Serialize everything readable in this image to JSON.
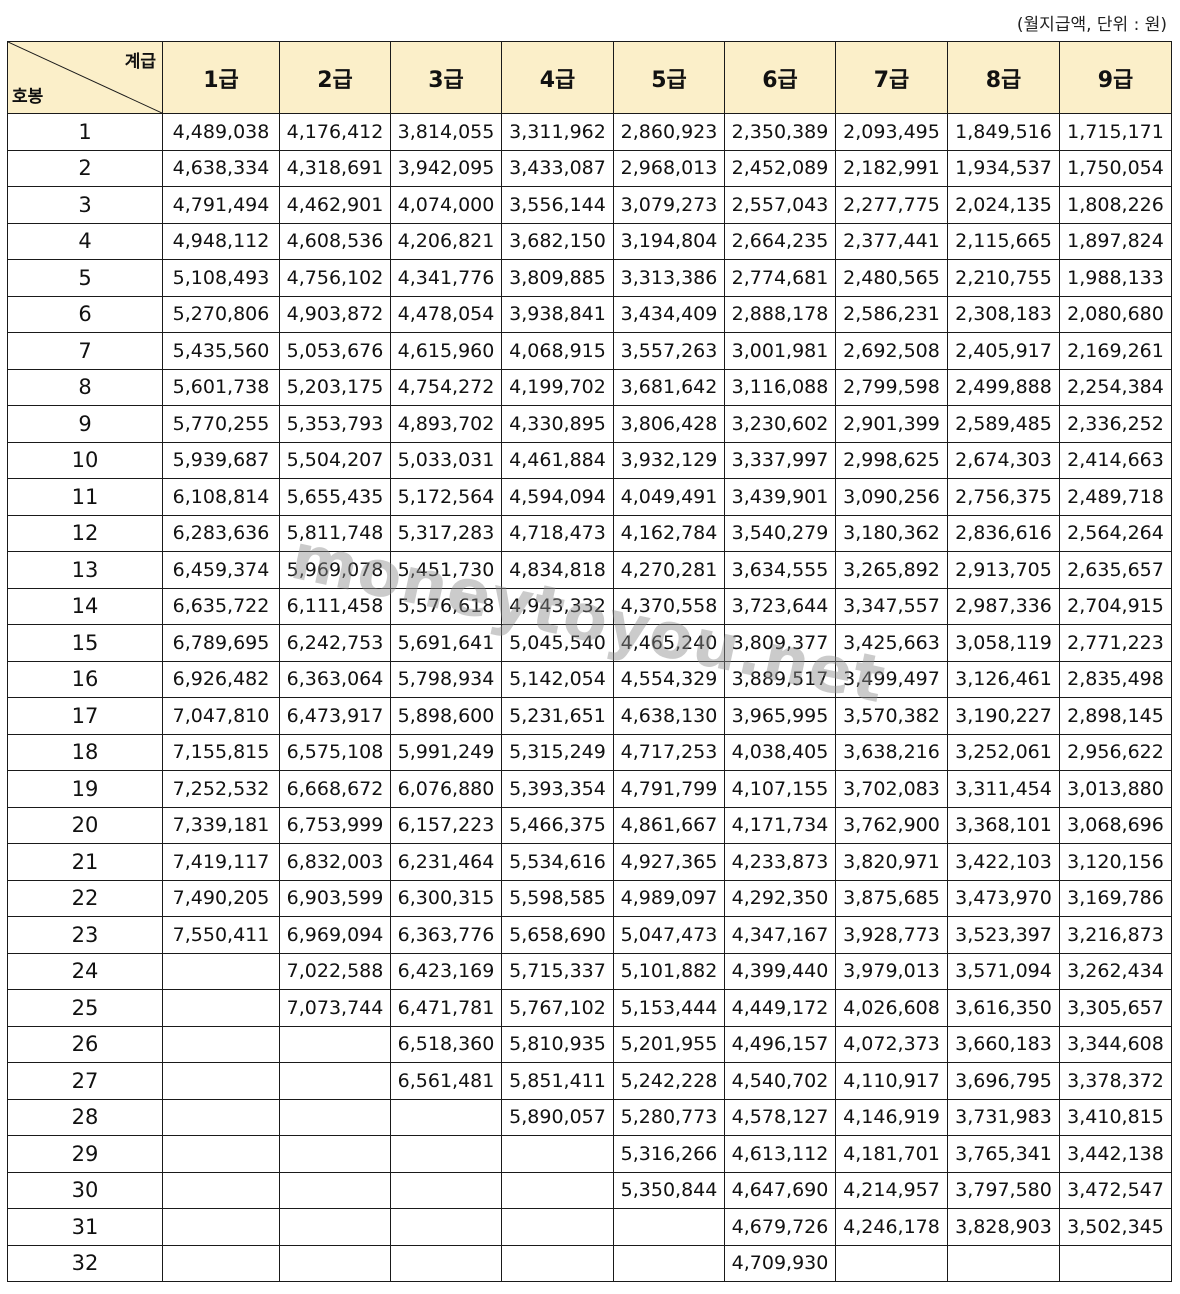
{
  "unit_note": "(월지급액, 단위 : 원)",
  "corner": {
    "column_label": "계급",
    "row_label": "호봉"
  },
  "grades": [
    "1급",
    "2급",
    "3급",
    "4급",
    "5급",
    "6급",
    "7급",
    "8급",
    "9급"
  ],
  "rows": [
    {
      "step": "1",
      "values": [
        "4,489,038",
        "4,176,412",
        "3,814,055",
        "3,311,962",
        "2,860,923",
        "2,350,389",
        "2,093,495",
        "1,849,516",
        "1,715,171"
      ]
    },
    {
      "step": "2",
      "values": [
        "4,638,334",
        "4,318,691",
        "3,942,095",
        "3,433,087",
        "2,968,013",
        "2,452,089",
        "2,182,991",
        "1,934,537",
        "1,750,054"
      ]
    },
    {
      "step": "3",
      "values": [
        "4,791,494",
        "4,462,901",
        "4,074,000",
        "3,556,144",
        "3,079,273",
        "2,557,043",
        "2,277,775",
        "2,024,135",
        "1,808,226"
      ]
    },
    {
      "step": "4",
      "values": [
        "4,948,112",
        "4,608,536",
        "4,206,821",
        "3,682,150",
        "3,194,804",
        "2,664,235",
        "2,377,441",
        "2,115,665",
        "1,897,824"
      ]
    },
    {
      "step": "5",
      "values": [
        "5,108,493",
        "4,756,102",
        "4,341,776",
        "3,809,885",
        "3,313,386",
        "2,774,681",
        "2,480,565",
        "2,210,755",
        "1,988,133"
      ]
    },
    {
      "step": "6",
      "values": [
        "5,270,806",
        "4,903,872",
        "4,478,054",
        "3,938,841",
        "3,434,409",
        "2,888,178",
        "2,586,231",
        "2,308,183",
        "2,080,680"
      ]
    },
    {
      "step": "7",
      "values": [
        "5,435,560",
        "5,053,676",
        "4,615,960",
        "4,068,915",
        "3,557,263",
        "3,001,981",
        "2,692,508",
        "2,405,917",
        "2,169,261"
      ]
    },
    {
      "step": "8",
      "values": [
        "5,601,738",
        "5,203,175",
        "4,754,272",
        "4,199,702",
        "3,681,642",
        "3,116,088",
        "2,799,598",
        "2,499,888",
        "2,254,384"
      ]
    },
    {
      "step": "9",
      "values": [
        "5,770,255",
        "5,353,793",
        "4,893,702",
        "4,330,895",
        "3,806,428",
        "3,230,602",
        "2,901,399",
        "2,589,485",
        "2,336,252"
      ]
    },
    {
      "step": "10",
      "values": [
        "5,939,687",
        "5,504,207",
        "5,033,031",
        "4,461,884",
        "3,932,129",
        "3,337,997",
        "2,998,625",
        "2,674,303",
        "2,414,663"
      ]
    },
    {
      "step": "11",
      "values": [
        "6,108,814",
        "5,655,435",
        "5,172,564",
        "4,594,094",
        "4,049,491",
        "3,439,901",
        "3,090,256",
        "2,756,375",
        "2,489,718"
      ]
    },
    {
      "step": "12",
      "values": [
        "6,283,636",
        "5,811,748",
        "5,317,283",
        "4,718,473",
        "4,162,784",
        "3,540,279",
        "3,180,362",
        "2,836,616",
        "2,564,264"
      ]
    },
    {
      "step": "13",
      "values": [
        "6,459,374",
        "5,969,078",
        "5,451,730",
        "4,834,818",
        "4,270,281",
        "3,634,555",
        "3,265,892",
        "2,913,705",
        "2,635,657"
      ]
    },
    {
      "step": "14",
      "values": [
        "6,635,722",
        "6,111,458",
        "5,576,618",
        "4,943,332",
        "4,370,558",
        "3,723,644",
        "3,347,557",
        "2,987,336",
        "2,704,915"
      ]
    },
    {
      "step": "15",
      "values": [
        "6,789,695",
        "6,242,753",
        "5,691,641",
        "5,045,540",
        "4,465,240",
        "3,809,377",
        "3,425,663",
        "3,058,119",
        "2,771,223"
      ]
    },
    {
      "step": "16",
      "values": [
        "6,926,482",
        "6,363,064",
        "5,798,934",
        "5,142,054",
        "4,554,329",
        "3,889,517",
        "3,499,497",
        "3,126,461",
        "2,835,498"
      ]
    },
    {
      "step": "17",
      "values": [
        "7,047,810",
        "6,473,917",
        "5,898,600",
        "5,231,651",
        "4,638,130",
        "3,965,995",
        "3,570,382",
        "3,190,227",
        "2,898,145"
      ]
    },
    {
      "step": "18",
      "values": [
        "7,155,815",
        "6,575,108",
        "5,991,249",
        "5,315,249",
        "4,717,253",
        "4,038,405",
        "3,638,216",
        "3,252,061",
        "2,956,622"
      ]
    },
    {
      "step": "19",
      "values": [
        "7,252,532",
        "6,668,672",
        "6,076,880",
        "5,393,354",
        "4,791,799",
        "4,107,155",
        "3,702,083",
        "3,311,454",
        "3,013,880"
      ]
    },
    {
      "step": "20",
      "values": [
        "7,339,181",
        "6,753,999",
        "6,157,223",
        "5,466,375",
        "4,861,667",
        "4,171,734",
        "3,762,900",
        "3,368,101",
        "3,068,696"
      ]
    },
    {
      "step": "21",
      "values": [
        "7,419,117",
        "6,832,003",
        "6,231,464",
        "5,534,616",
        "4,927,365",
        "4,233,873",
        "3,820,971",
        "3,422,103",
        "3,120,156"
      ]
    },
    {
      "step": "22",
      "values": [
        "7,490,205",
        "6,903,599",
        "6,300,315",
        "5,598,585",
        "4,989,097",
        "4,292,350",
        "3,875,685",
        "3,473,970",
        "3,169,786"
      ]
    },
    {
      "step": "23",
      "values": [
        "7,550,411",
        "6,969,094",
        "6,363,776",
        "5,658,690",
        "5,047,473",
        "4,347,167",
        "3,928,773",
        "3,523,397",
        "3,216,873"
      ]
    },
    {
      "step": "24",
      "values": [
        "",
        "7,022,588",
        "6,423,169",
        "5,715,337",
        "5,101,882",
        "4,399,440",
        "3,979,013",
        "3,571,094",
        "3,262,434"
      ]
    },
    {
      "step": "25",
      "values": [
        "",
        "7,073,744",
        "6,471,781",
        "5,767,102",
        "5,153,444",
        "4,449,172",
        "4,026,608",
        "3,616,350",
        "3,305,657"
      ]
    },
    {
      "step": "26",
      "values": [
        "",
        "",
        "6,518,360",
        "5,810,935",
        "5,201,955",
        "4,496,157",
        "4,072,373",
        "3,660,183",
        "3,344,608"
      ]
    },
    {
      "step": "27",
      "values": [
        "",
        "",
        "6,561,481",
        "5,851,411",
        "5,242,228",
        "4,540,702",
        "4,110,917",
        "3,696,795",
        "3,378,372"
      ]
    },
    {
      "step": "28",
      "values": [
        "",
        "",
        "",
        "5,890,057",
        "5,280,773",
        "4,578,127",
        "4,146,919",
        "3,731,983",
        "3,410,815"
      ]
    },
    {
      "step": "29",
      "values": [
        "",
        "",
        "",
        "",
        "5,316,266",
        "4,613,112",
        "4,181,701",
        "3,765,341",
        "3,442,138"
      ]
    },
    {
      "step": "30",
      "values": [
        "",
        "",
        "",
        "",
        "5,350,844",
        "4,647,690",
        "4,214,957",
        "3,797,580",
        "3,472,547"
      ]
    },
    {
      "step": "31",
      "values": [
        "",
        "",
        "",
        "",
        "",
        "4,679,726",
        "4,246,178",
        "3,828,903",
        "3,502,345"
      ]
    },
    {
      "step": "32",
      "values": [
        "",
        "",
        "",
        "",
        "",
        "4,709,930",
        "",
        "",
        ""
      ]
    }
  ],
  "watermark": "moneytoyou.net"
}
